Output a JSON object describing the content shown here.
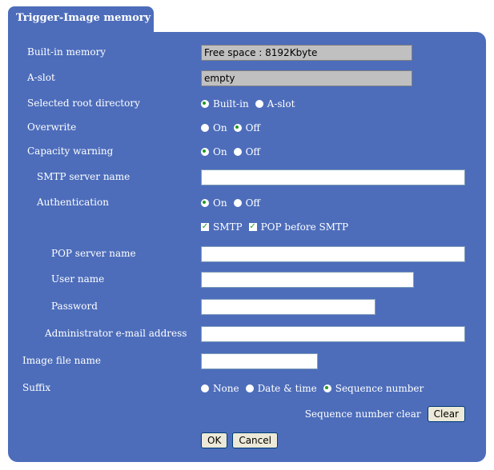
{
  "tab_title": "Trigger-Image memory",
  "builtin_memory": {
    "label": "Built-in memory",
    "value": "Free space : 8192Kbyte"
  },
  "a_slot": {
    "label": "A-slot",
    "value": "empty"
  },
  "root_dir": {
    "label": "Selected root directory",
    "opt1": "Built-in",
    "opt2": "A-slot",
    "selected": "Built-in"
  },
  "overwrite": {
    "label": "Overwrite",
    "opt1": "On",
    "opt2": "Off",
    "selected": "Off"
  },
  "capacity": {
    "label": "Capacity warning",
    "opt1": "On",
    "opt2": "Off",
    "selected": "On"
  },
  "smtp_server": {
    "label": "SMTP server name",
    "value": ""
  },
  "auth": {
    "label": "Authentication",
    "opt1": "On",
    "opt2": "Off",
    "selected": "On",
    "smtp": "SMTP",
    "pop": "POP before SMTP"
  },
  "pop_server": {
    "label": "POP server name",
    "value": ""
  },
  "user_name": {
    "label": "User name",
    "value": ""
  },
  "password": {
    "label": "Password",
    "value": ""
  },
  "admin_email": {
    "label": "Administrator e-mail address",
    "value": ""
  },
  "image_file": {
    "label": "Image file name",
    "value": ""
  },
  "suffix": {
    "label": "Suffix",
    "opt1": "None",
    "opt2": "Date & time",
    "opt3": "Sequence number",
    "selected": "Sequence number"
  },
  "seq_clear": {
    "label": "Sequence number clear",
    "button": "Clear"
  },
  "buttons": {
    "ok": "OK",
    "cancel": "Cancel"
  }
}
